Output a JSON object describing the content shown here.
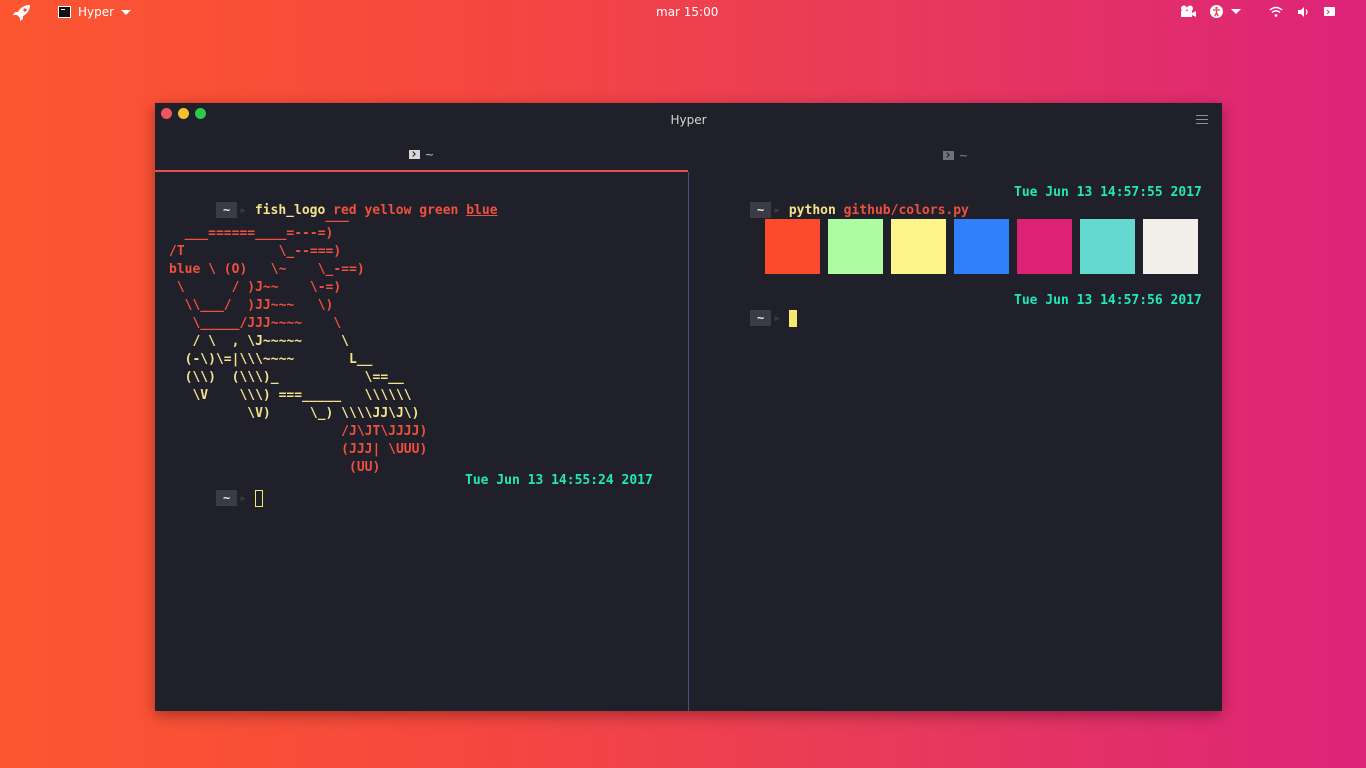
{
  "topbar": {
    "app_name": "Hyper",
    "clock": "mar 15:00",
    "icons": [
      "rocket-icon",
      "terminal-icon",
      "camera-icon",
      "accessibility-icon",
      "wifi-icon",
      "volume-icon",
      "battery-icon"
    ]
  },
  "window": {
    "title": "Hyper",
    "tabs": [
      {
        "label": "~"
      },
      {
        "label": "~"
      }
    ]
  },
  "left_pane": {
    "prompt_dir": "~",
    "command": {
      "name": "fish_logo",
      "args": [
        "red",
        "yellow",
        "green",
        "blue"
      ]
    },
    "logo_lines": [
      "                    ___",
      "  ___======____=---=)",
      "/T            \\_--===)",
      "blue \\ (O)   \\~    \\_-==)",
      " \\      / )J~~    \\-=)",
      "  \\\\___/  )JJ~~~   \\)",
      "   \\_____/JJJ~~~~    \\",
      "   / \\  , \\J~~~~~     \\",
      "  (-\\)\\=|\\\\\\~~~~       L__",
      "  (\\\\)  (\\\\\\)_           \\==__",
      "   \\V    \\\\\\) ===_____   \\\\\\\\\\\\",
      "          \\V)     \\_) \\\\\\\\JJ\\J\\)",
      "                      /J\\JT\\JJJJ)",
      "                      (JJJ| \\UUU)",
      "                       (UU)"
    ],
    "second_prompt_dir": "~",
    "timestamp": "Tue Jun 13 14:55:24 2017"
  },
  "right_pane": {
    "prompt_dir": "~",
    "command": {
      "name": "python",
      "args": "github/colors.py"
    },
    "timestamp_1": "Tue Jun 13 14:57:55 2017",
    "swatches": [
      "#fc4a2c",
      "#adfca1",
      "#fdf58a",
      "#3080fc",
      "#dd2275",
      "#63d9d0",
      "#f2efea"
    ],
    "second_prompt_dir": "~",
    "timestamp_2": "Tue Jun 13 14:57:56 2017"
  },
  "colors": {
    "prompt_badge": "#3a3b45",
    "timestamp": "#21e8b8",
    "accent_tab": "#e6504f",
    "terminal_bg": "#1f2029"
  }
}
